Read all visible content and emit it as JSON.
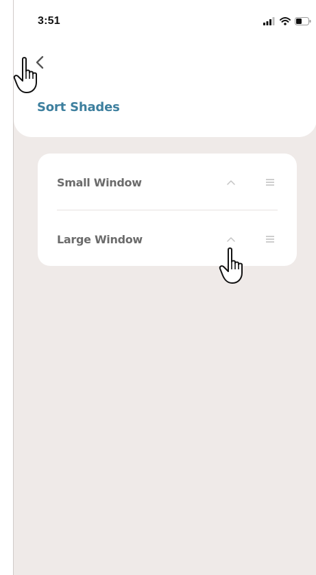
{
  "status_bar": {
    "time": "3:51",
    "icons": [
      "signal-icon",
      "wifi-icon",
      "battery-icon"
    ]
  },
  "header": {
    "back_icon": "chevron-left-icon",
    "title": "Sort Shades"
  },
  "shades": [
    {
      "label": "Small Window",
      "move_icon": "chevron-up-icon",
      "drag_icon": "drag-handle-icon"
    },
    {
      "label": "Large Window",
      "move_icon": "chevron-up-icon",
      "drag_icon": "drag-handle-icon"
    }
  ],
  "overlay": {
    "cursor_icon": "pointing-hand-icon"
  },
  "colors": {
    "background": "#efeae8",
    "card": "#ffffff",
    "title_accent": "#3d7f9e",
    "label_text": "#6b6b6b",
    "icon_muted": "#b9b9b9"
  }
}
